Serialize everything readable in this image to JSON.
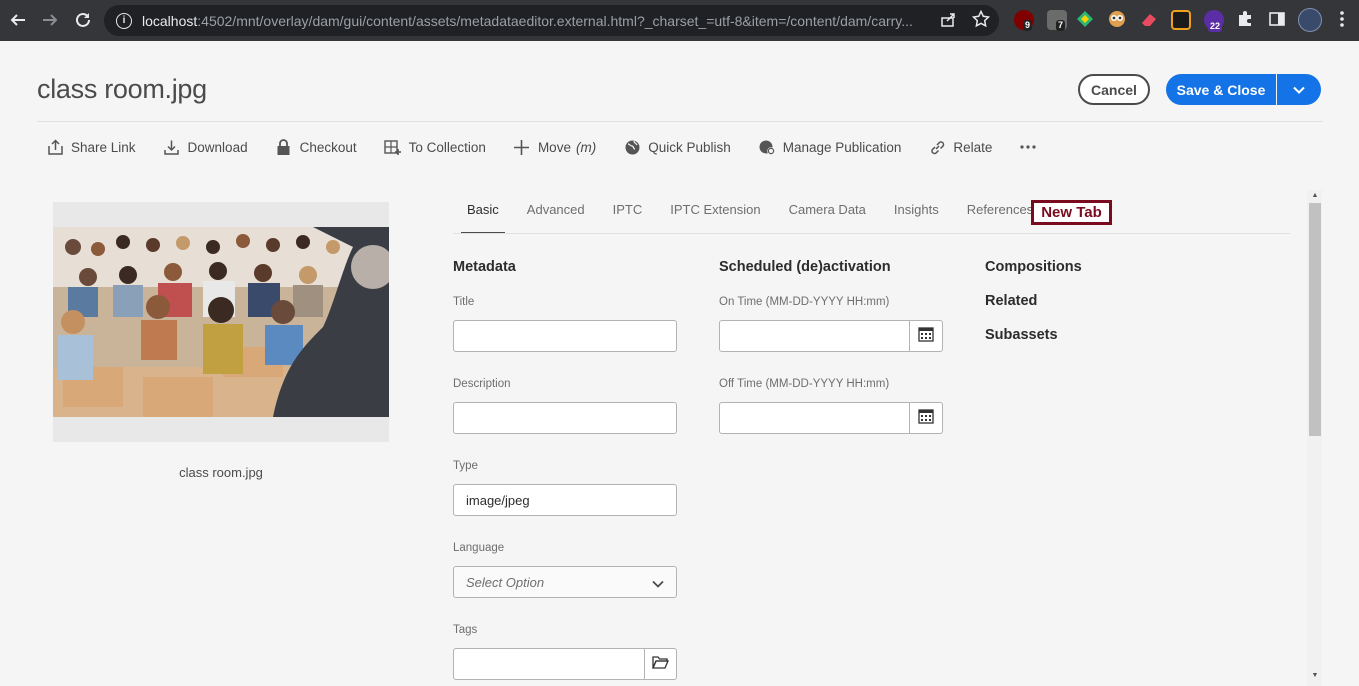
{
  "browser": {
    "url_host": "localhost",
    "url_rest": ":4502/mnt/overlay/dam/gui/content/assets/metadataeditor.external.html?_charset_=utf-8&item=/content/dam/carry...",
    "ext_badges": [
      "9",
      "7",
      "22"
    ]
  },
  "header": {
    "title": "class room.jpg",
    "cancel_label": "Cancel",
    "save_label": "Save & Close"
  },
  "actions": [
    {
      "label": "Share Link",
      "icon": "share-icon"
    },
    {
      "label": "Download",
      "icon": "download-icon"
    },
    {
      "label": "Checkout",
      "icon": "lock-icon"
    },
    {
      "label": "To Collection",
      "icon": "collection-icon"
    },
    {
      "label": "Move",
      "shortcut": "(m)",
      "icon": "move-icon"
    },
    {
      "label": "Quick Publish",
      "icon": "globe-icon"
    },
    {
      "label": "Manage Publication",
      "icon": "manage-publication-icon"
    },
    {
      "label": "Relate",
      "icon": "link-icon"
    }
  ],
  "preview": {
    "caption": "class room.jpg"
  },
  "tabs": [
    "Basic",
    "Advanced",
    "IPTC",
    "IPTC Extension",
    "Camera Data",
    "Insights",
    "References"
  ],
  "new_tab_label": "New Tab",
  "metadata": {
    "heading": "Metadata",
    "title_label": "Title",
    "title_value": "",
    "description_label": "Description",
    "description_value": "",
    "type_label": "Type",
    "type_value": "image/jpeg",
    "language_label": "Language",
    "language_placeholder": "Select Option",
    "tags_label": "Tags"
  },
  "scheduled": {
    "heading": "Scheduled (de)activation",
    "on_time_label": "On Time (MM-DD-YYYY HH:mm)",
    "off_time_label": "Off Time (MM-DD-YYYY HH:mm)"
  },
  "side_links": [
    "Compositions",
    "Related",
    "Subassets"
  ],
  "colors": {
    "primary": "#1473e6",
    "highlight": "#7a0a1e"
  }
}
